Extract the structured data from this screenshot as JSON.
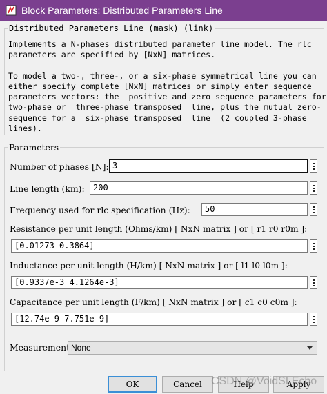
{
  "window": {
    "title": "Block Parameters: Distributed Parameters Line",
    "icon": "simulink-block-icon",
    "accent_color": "#7b3f8f"
  },
  "description": {
    "legend": "Distributed Parameters Line (mask) (link)",
    "lines": [
      "Implements a N-phases distributed parameter line model. The rlc",
      "parameters are specified by [NxN] matrices.",
      "",
      "To model a two-, three-, or a six-phase symmetrical line you can",
      "either specify complete [NxN] matrices or simply enter sequence",
      "parameters vectors: the  positive and zero sequence parameters for a",
      "two-phase or  three-phase transposed  line, plus the mutual zero-",
      "sequence for a  six-phase transposed  line  (2 coupled 3-phase",
      "lines)."
    ]
  },
  "parameters": {
    "legend": "Parameters",
    "num_phases": {
      "label": "Number of phases [N]:",
      "value": "3"
    },
    "line_length": {
      "label": "Line length (km):",
      "value": "200"
    },
    "frequency": {
      "label": "Frequency used for rlc specification (Hz):",
      "value": "50"
    },
    "resistance": {
      "label": "Resistance per unit length (Ohms/km) [ NxN matrix ] or [ r1 r0 r0m ]:",
      "value": "[0.01273 0.3864]"
    },
    "inductance": {
      "label": "Inductance per unit length (H/km) [ NxN matrix ] or [ l1 l0 l0m ]:",
      "value": "[0.9337e-3  4.1264e-3]"
    },
    "capacitance": {
      "label": "Capacitance per unit length (F/km) [ NxN matrix ] or [ c1 c0 c0m ]:",
      "value": "[12.74e-9 7.751e-9]"
    }
  },
  "measurements": {
    "label": "Measurements",
    "selected": "None"
  },
  "buttons": {
    "ok": "OK",
    "cancel": "Cancel",
    "help": "Help",
    "apply": "Apply"
  },
  "watermark": "CSDN @VoidSLEcho"
}
